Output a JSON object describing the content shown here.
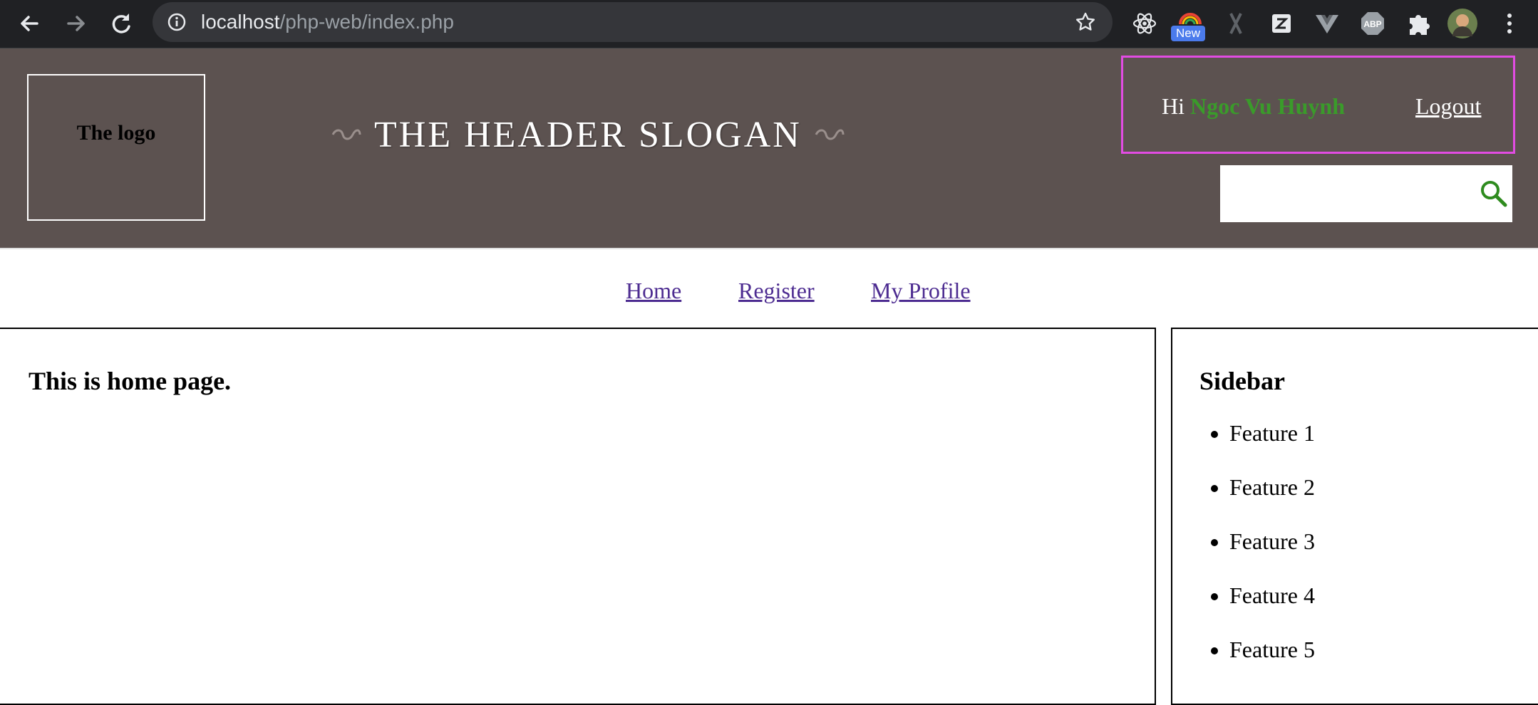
{
  "browser": {
    "url_host": "localhost",
    "url_path": "/php-web/index.php",
    "new_badge": "New",
    "icons": [
      "back-icon",
      "forward-icon",
      "reload-icon",
      "info-icon",
      "star-icon",
      "react-icon",
      "chromecast-icon",
      "x-icon",
      "z-icon",
      "vue-icon",
      "abp-icon",
      "puzzle-icon",
      "avatar",
      "menu-icon"
    ]
  },
  "header": {
    "logo": "The logo",
    "slogan": "THE HEADER SLOGAN",
    "greeting": "Hi",
    "user_name": "Ngoc Vu Huynh",
    "logout": "Logout",
    "search_placeholder": ""
  },
  "nav": {
    "items": [
      {
        "label": "Home"
      },
      {
        "label": "Register"
      },
      {
        "label": "My Profile"
      }
    ]
  },
  "content": {
    "title": "This is home page."
  },
  "sidebar": {
    "title": "Sidebar",
    "features": [
      "Feature 1",
      "Feature 2",
      "Feature 3",
      "Feature 4",
      "Feature 5"
    ]
  },
  "colors": {
    "header_bg": "#5c5250",
    "user_name": "#3a9b2a",
    "user_box_border": "#e24ce3",
    "nav_link": "#4d2c91"
  }
}
